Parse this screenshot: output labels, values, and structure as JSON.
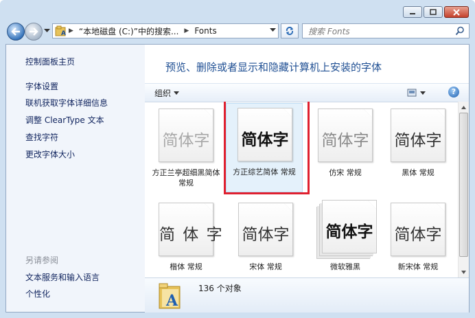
{
  "window": {
    "address": {
      "segments": [
        "“本地磁盘 (C:)”中的搜索...",
        "Fonts"
      ],
      "arrow": "▶"
    },
    "search_placeholder": "搜索 Fonts",
    "icons": [
      "back-arrow-icon",
      "forward-arrow-icon",
      "folder-icon",
      "refresh-icon",
      "search-icon",
      "minimize-icon",
      "maximize-icon",
      "close-icon"
    ]
  },
  "sidebar": {
    "home": "控制面板主页",
    "links": [
      "字体设置",
      "联机获取字体详细信息",
      "调整 ClearType 文本",
      "查找字符",
      "更改字体大小"
    ],
    "see_also_heading": "另请参阅",
    "see_also": [
      "文本服务和输入语言",
      "个性化"
    ]
  },
  "main": {
    "title": "预览、删除或者显示和隐藏计算机上安装的字体",
    "organize": "组织",
    "help": "?",
    "fonts": [
      {
        "sample": "简体字",
        "label": "方正兰亭超细黑简体 常规",
        "style": "thin"
      },
      {
        "sample": "简体字",
        "label": "方正综艺简体 常规",
        "style": "bold",
        "selected": true
      },
      {
        "sample": "简体字",
        "label": "仿宋 常规",
        "style": "thin"
      },
      {
        "sample": "简体字",
        "label": "黑体 常规",
        "style": "reg"
      },
      {
        "sample": "简 体 字",
        "label": "楷体 常规",
        "style": "spaced"
      },
      {
        "sample": "简体字",
        "label": "宋体 常规",
        "style": "reg"
      },
      {
        "sample": "简体字",
        "label": "微软雅黑",
        "style": "bold",
        "stack": true
      },
      {
        "sample": "简体字",
        "label": "新宋体 常规",
        "style": "reg"
      }
    ],
    "details": {
      "count": "136 个对象"
    }
  },
  "colors": {
    "highlight_border": "#e0202f",
    "link": "#10245e",
    "title": "#1f4f93"
  }
}
